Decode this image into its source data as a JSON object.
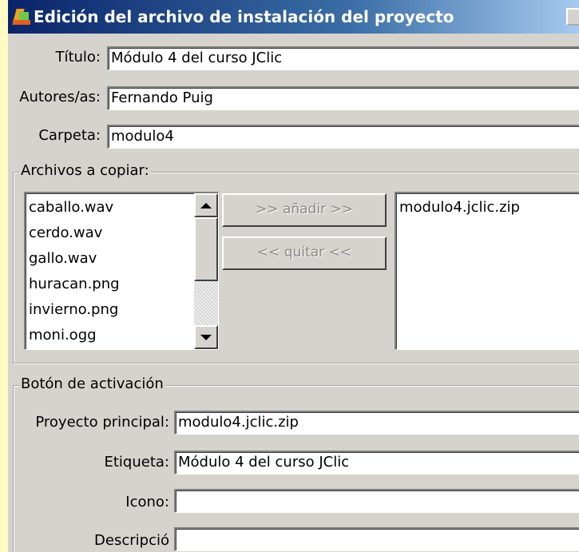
{
  "window": {
    "title": "Edición del archivo de instalación del proyecto"
  },
  "project": {
    "title_label": "Título:",
    "title_value": "Módulo 4 del curso JClic",
    "authors_label": "Autores/as:",
    "authors_value": "Fernando Puig",
    "folder_label": "Carpeta:",
    "folder_value": "modulo4"
  },
  "files": {
    "group_label": "Archivos a copiar:",
    "available": [
      "caballo.wav",
      "cerdo.wav",
      "gallo.wav",
      "huracan.png",
      "invierno.png",
      "moni.ogg"
    ],
    "add_label": ">> añadir >>",
    "remove_label": "<< quitar <<",
    "selected": [
      "modulo4.jclic.zip"
    ]
  },
  "activation": {
    "group_label": "Botón de activación",
    "main_project_label": "Proyecto principal:",
    "main_project_value": "modulo4.jclic.zip",
    "tag_label": "Etiqueta:",
    "tag_value": "Módulo 4 del curso JClic",
    "icon_label": "Icono:",
    "icon_value": "",
    "description_label": "Descripció",
    "description_value": ""
  },
  "colors": {
    "page_background": "#fffbc4",
    "window_background": "#d6d3ce",
    "titlebar_start": "#0a246a",
    "titlebar_end": "#a6caf0"
  },
  "icons": {
    "app": "jclic-app-icon",
    "scroll_up": "scroll-up-arrow-icon",
    "scroll_down": "scroll-down-arrow-icon"
  }
}
